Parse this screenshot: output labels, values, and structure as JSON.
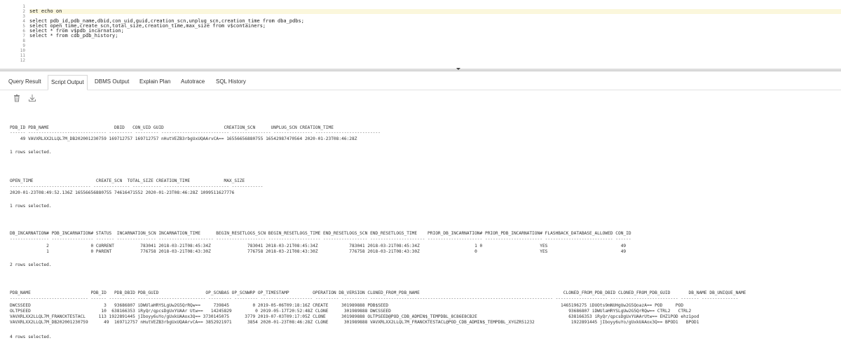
{
  "editor": {
    "line_numbers": [
      "1",
      "2",
      "3",
      "4",
      "5",
      "6",
      "7",
      "8",
      "9",
      "10",
      "11",
      "12"
    ],
    "lines": [
      "",
      "set echo on",
      "",
      "select pdb_id,pdb_name,dbid,con_uid,guid,creation_scn,unplug_scn,creation_time from dba_pdbs;",
      "select open_time,create_scn,total_size,creation_time,max_size from v$containers;",
      "select * from v$pdb_incarnation;",
      "select * from cdb_pdb_history;",
      "",
      "",
      "",
      "",
      ""
    ]
  },
  "tabs": [
    "Query Result",
    "Script Output",
    "DBMS Output",
    "Explain Plan",
    "Autotrace",
    "SQL History"
  ],
  "active_tab": "Script Output",
  "toolbar": {
    "icons": [
      "trash-icon",
      "download-icon"
    ]
  },
  "output": {
    "q1_header": "PDB_ID PDB_NAME                         DBID   CON_UID GUID                       CREATION_SCN      UNPLUG_SCN CREATION_TIME",
    "q1_sep": "------ ------------------------------ --------- --------- -------------------------- --------------- --------------- -------------------------",
    "q1_row": "    49 VAVXRLXX2LLQL7M_DB202001230759 169712757 169712757 nHutVEZB3rbgUxUQAArvCA== 16556656880755 16542987470564 2020-01-23T08:46:28Z",
    "q1_status": "1 rows selected.",
    "q2_header": "OPEN_TIME                        CREATE_SCN  TOTAL_SIZE CREATION_TIME             MAX_SIZE",
    "q2_sep": "------------------------------- -------------- ----------- ------------------------- ------------",
    "q2_row": "2020-01-23T08:49:52.136Z 16556656880755 74616471552 2020-01-23T08:46:28Z 1099511627776",
    "q2_status": "1 rows selected.",
    "q3_header": "DB_INCARNATION# PDB_INCARNATION# STATUS  INCARNATION_SCN INCARNATION_TIME      BEGIN_RESETLOGS_SCN BEGIN_RESETLOGS_TIME END_RESETLOGS_SCN END_RESETLOGS_TIME    PRIOR_DB_INCARNATION# PRIOR_PDB_INCARNATION# FLASHBACK_DATABASE_ALLOWED CON_ID",
    "q3_sep": "--------------- ---------------- ------- --------------- --------------------- ------------------- -------------------- ----------------- --------------------- --------------------- ---------------------- -------------------------- ------",
    "q3_row1": "              2                0 CURRENT          783041 2018-03-21T08:45:34Z              783041 2018-03-21T08:45:34Z            783041 2018-03-21T08:45:34Z                     1 0                      YES                            49",
    "q3_row2": "              1                0 PARENT           776758 2018-03-21T08:43:30Z              776758 2018-03-21T08:43:30Z            776758 2018-03-21T08:43:30Z                     0                        YES                            49",
    "q3_status": "2 rows selected.",
    "q4_header": "PDB_NAME                       PDB_ID   PDB_DBID PDB_GUID                  OP_SCNBAS OP_SCNWRP OP_TIMESTAMP         OPERATION DB_VERSION CLONED_FROM_PDB_NAME                                                       CLONED_FROM_PDB_DBID CLONED_FROM_PDB_GUID       DB_NAME DB_UNIQUE_NAME",
    "q4_sep": "------------------------------ ------ ---------- -------------------------- --------- --------- -------------------- --------- ---------- ---------------------------------------------------------------------- -------------------- -------------------------- ------- --------------",
    "q4_row1": "DWCSSEED                            3   93686807 iDWUlaHRYSLgUw2G5QrRQw==     739845         0 2019-05-06T09:18:16Z CREATE     301989888 PDB$SEED                                                                  1465196275 iDUOts9mNUHgUw2G5QoazA== POD     POD",
    "q4_row2": "OLTPSEED                           10  638166353 iRyQr/qpcsDgUxYUAAr Utw==   14245829         0 2019-05-17T20:52:48Z CLONE      301989888 DWCSSEED                                                                    93686807 iDWUlaHRYSLgUw2G5QrRQw== CTRL2   CTRL2",
    "q4_row3": "VAVXRLXX2LLQL7M_FRANCKTESTACL     113 1922891445 jIboyy6uYo/gUxkUAAox3Q== 3730145075      3779 2019-07-03T09:17:05Z CLONE      301989888 OLTPSEED@POD_CDB_ADMIN$_TEMPDBL_8C86E8CB2E                                   638166353 iRyQr/qpcsDgUxYUAArUtw== EHZ1POD ehz1pod",
    "q4_row4": "VAVXRLXX2LLQL7M_DB202001230759      49  169712757 nHutVEZB3rbgUxUQAArvCA== 3852921971      3854 2020-01-23T08:46:28Z CLONE      301989888 VAVXRLXX2LLQL7M_FRANCKTESTACL@POD_CDB_ADMIN$_TEMPDBL_XYGZR51232              1922891445 jIboyy6uYo/gUxkUAAox3Q== BPOD1   BPOD1",
    "q4_status": "4 rows selected."
  }
}
